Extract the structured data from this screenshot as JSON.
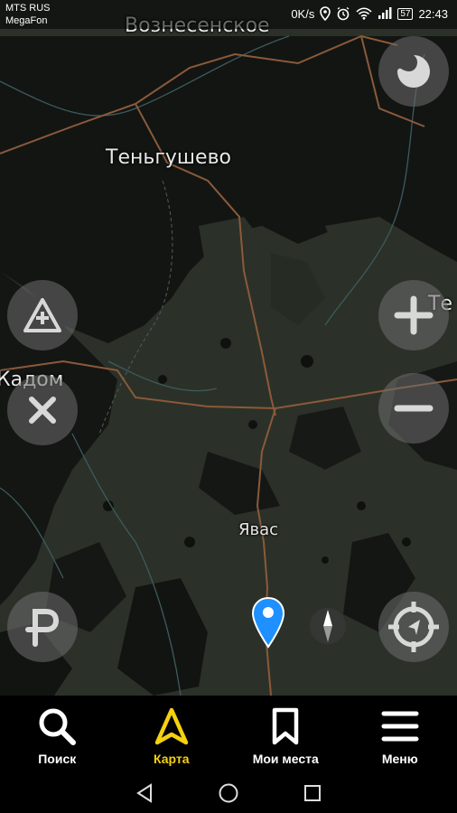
{
  "status_bar": {
    "carrier_1": "MTS RUS",
    "carrier_2": "MegaFon",
    "net_speed": "0K/s",
    "battery": "57",
    "time": "22:43"
  },
  "map": {
    "labels": {
      "voznesenskoe": "Вознесенское",
      "tengushevo": "Теньгушево",
      "kadom": "Кадом",
      "yavas": "Явас",
      "te": "Те"
    }
  },
  "bottom_nav": {
    "items": [
      {
        "label": "Поиск",
        "icon": "search-icon"
      },
      {
        "label": "Карта",
        "icon": "navigation-arrow-icon"
      },
      {
        "label": "Мои места",
        "icon": "bookmark-icon"
      },
      {
        "label": "Меню",
        "icon": "hamburger-menu-icon"
      }
    ],
    "active_index": 1
  },
  "colors": {
    "accent": "#f5d10e",
    "map_forest": "#2b3128",
    "map_dark": "#101210",
    "road": "#8a5a3a",
    "pin": "#1e90ff"
  }
}
